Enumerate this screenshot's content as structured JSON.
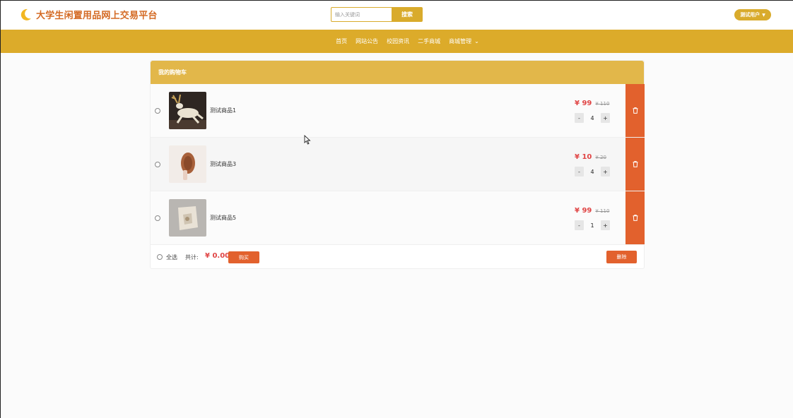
{
  "header": {
    "title": "大学生闲置用品网上交易平台",
    "search_placeholder": "输入关键词",
    "search_button": "搜索",
    "user_label": "测试用户",
    "brand_color": "#d46a24",
    "accent_color": "#dcab2a"
  },
  "nav": {
    "items": [
      "首页",
      "网站公告",
      "校园资讯",
      "二手商城",
      "商城管理"
    ]
  },
  "cart": {
    "title": "我的购物车",
    "items": [
      {
        "name": "测试商品1",
        "price": "¥ 99",
        "old_price": "¥ 110",
        "quantity": "4",
        "image": "white-deer-figurine"
      },
      {
        "name": "测试商品3",
        "price": "¥ 10",
        "old_price": "¥ 20",
        "quantity": "4",
        "image": "wooden-round-craft"
      },
      {
        "name": "测试商品5",
        "price": "¥ 99",
        "old_price": "¥ 110",
        "quantity": "1",
        "image": "stone-carving"
      }
    ],
    "minus": "-",
    "plus": "+",
    "select_all": "全选",
    "total_label": "共计:",
    "total": "¥ 0.00",
    "buy_button": "购买",
    "delete_button": "删除"
  }
}
